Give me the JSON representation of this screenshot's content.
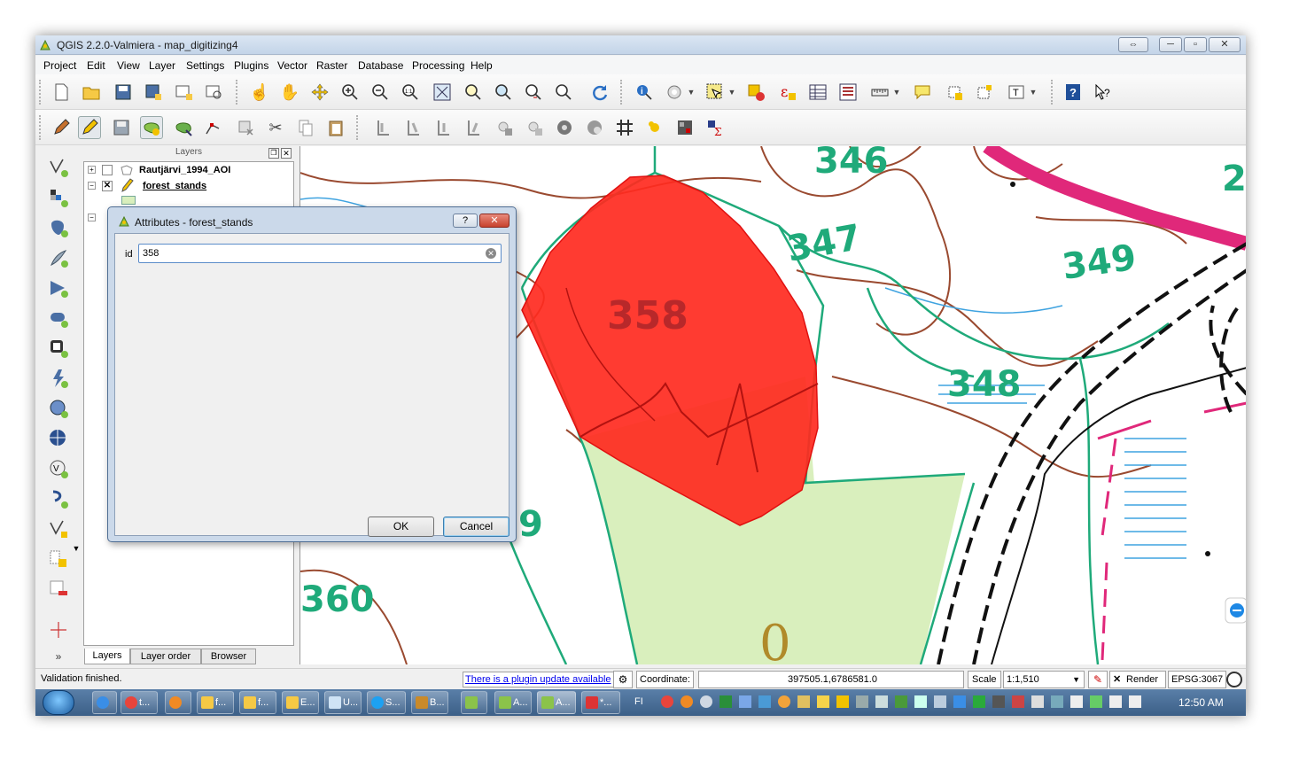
{
  "window": {
    "title": "QGIS 2.2.0-Valmiera - map_digitizing4",
    "restore_label": "⇔",
    "min_label": "─",
    "max_label": "▫",
    "close_label": "✕"
  },
  "menu": [
    "Project",
    "Edit",
    "View",
    "Layer",
    "Settings",
    "Plugins",
    "Vector",
    "Raster",
    "Database",
    "Processing",
    "Help"
  ],
  "layers_panel": {
    "header": "Layers",
    "items": [
      {
        "name": "Rautjärvi_1994_AOI",
        "checked": false
      },
      {
        "name": "forest_stands",
        "checked": true,
        "editing": true
      }
    ],
    "tabs": [
      "Layers",
      "Layer order",
      "Browser"
    ]
  },
  "dialog": {
    "title": "Attributes - forest_stands",
    "help_label": "?",
    "close_label": "✕",
    "field_label": "id",
    "field_value": "358",
    "ok_label": "OK",
    "cancel_label": "Cancel"
  },
  "map": {
    "labels": [
      "346",
      "347",
      "349",
      "348",
      "358",
      "360",
      "9",
      "2",
      "0"
    ],
    "selected_fill": "#ff2a1f",
    "stand_fill": "#d9efbd",
    "contour_color": "#9a4a30",
    "boundary_color": "#1faa7a"
  },
  "status": {
    "message": "Validation finished.",
    "plugin_update": "There is a plugin update available",
    "coordinate_label": "Coordinate:",
    "coordinate_value": "397505.1,6786581.0",
    "scale_label": "Scale",
    "scale_value": "1:1,510",
    "render_label": "Render",
    "epsg": "EPSG:3067"
  },
  "taskbar": {
    "items": [
      "t...",
      "f...",
      "f...",
      "E...",
      "U...",
      "S...",
      "B...",
      "A...",
      "A...",
      "*..."
    ],
    "language": "FI",
    "clock": "12:50 AM"
  },
  "colors": {
    "accent": "#3c5f87",
    "link": "#0000ee"
  }
}
